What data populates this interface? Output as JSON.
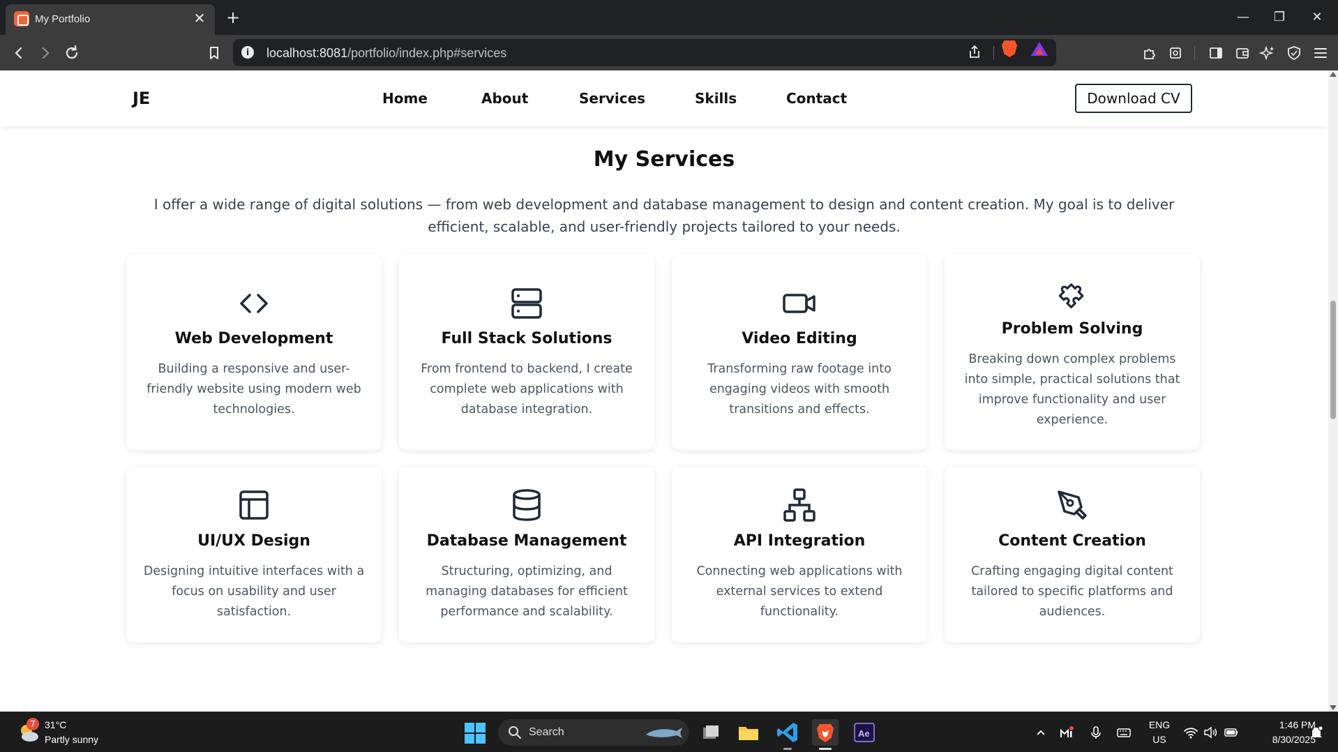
{
  "browser": {
    "tab_title": "My Portfolio",
    "new_tab_label": "+",
    "url_host": "localhost:8081",
    "url_path": "/portfolio/index.php#services",
    "minimize": "—",
    "restore": "❐",
    "close": "✕"
  },
  "site": {
    "logo": "JE",
    "nav": [
      {
        "label": "Home"
      },
      {
        "label": "About"
      },
      {
        "label": "Services"
      },
      {
        "label": "Skills"
      },
      {
        "label": "Contact"
      }
    ],
    "cta_label": "Download CV"
  },
  "services": {
    "title": "My Services",
    "description": "I offer a wide range of digital solutions — from web development and database management to design and content creation. My goal is to deliver efficient, scalable, and user-friendly projects tailored to your needs.",
    "cards": [
      {
        "icon": "code-icon",
        "title": "Web Development",
        "desc": "Building a responsive and user-friendly website using modern web technologies."
      },
      {
        "icon": "server-icon",
        "title": "Full Stack Solutions",
        "desc": "From frontend to backend, I create complete web applications with database integration."
      },
      {
        "icon": "video-icon",
        "title": "Video Editing",
        "desc": "Transforming raw footage into engaging videos with smooth transitions and effects."
      },
      {
        "icon": "puzzle-icon",
        "title": "Problem Solving",
        "desc": "Breaking down complex problems into simple, practical solutions that improve functionality and user experience."
      },
      {
        "icon": "layout-icon",
        "title": "UI/UX Design",
        "desc": "Designing intuitive interfaces with a focus on usability and user satisfaction."
      },
      {
        "icon": "database-icon",
        "title": "Database Management",
        "desc": "Structuring, optimizing, and managing databases for efficient performance and scalability."
      },
      {
        "icon": "network-icon",
        "title": "API Integration",
        "desc": "Connecting web applications with external services to extend functionality."
      },
      {
        "icon": "pen-tool-icon",
        "title": "Content Creation",
        "desc": "Crafting engaging digital content tailored to specific platforms and audiences."
      }
    ]
  },
  "taskbar": {
    "weather_temp": "31°C",
    "weather_cond": "Partly sunny",
    "weather_badge": "7",
    "search_placeholder": "Search",
    "lang_top": "ENG",
    "lang_bottom": "US",
    "time": "1:46 PM",
    "date": "8/30/2025"
  },
  "colors": {
    "accent": "#1f2937",
    "text_primary": "#111111",
    "text_secondary": "#4b5563",
    "browser_dark": "#202124",
    "toolbar": "#3c3c3c"
  }
}
